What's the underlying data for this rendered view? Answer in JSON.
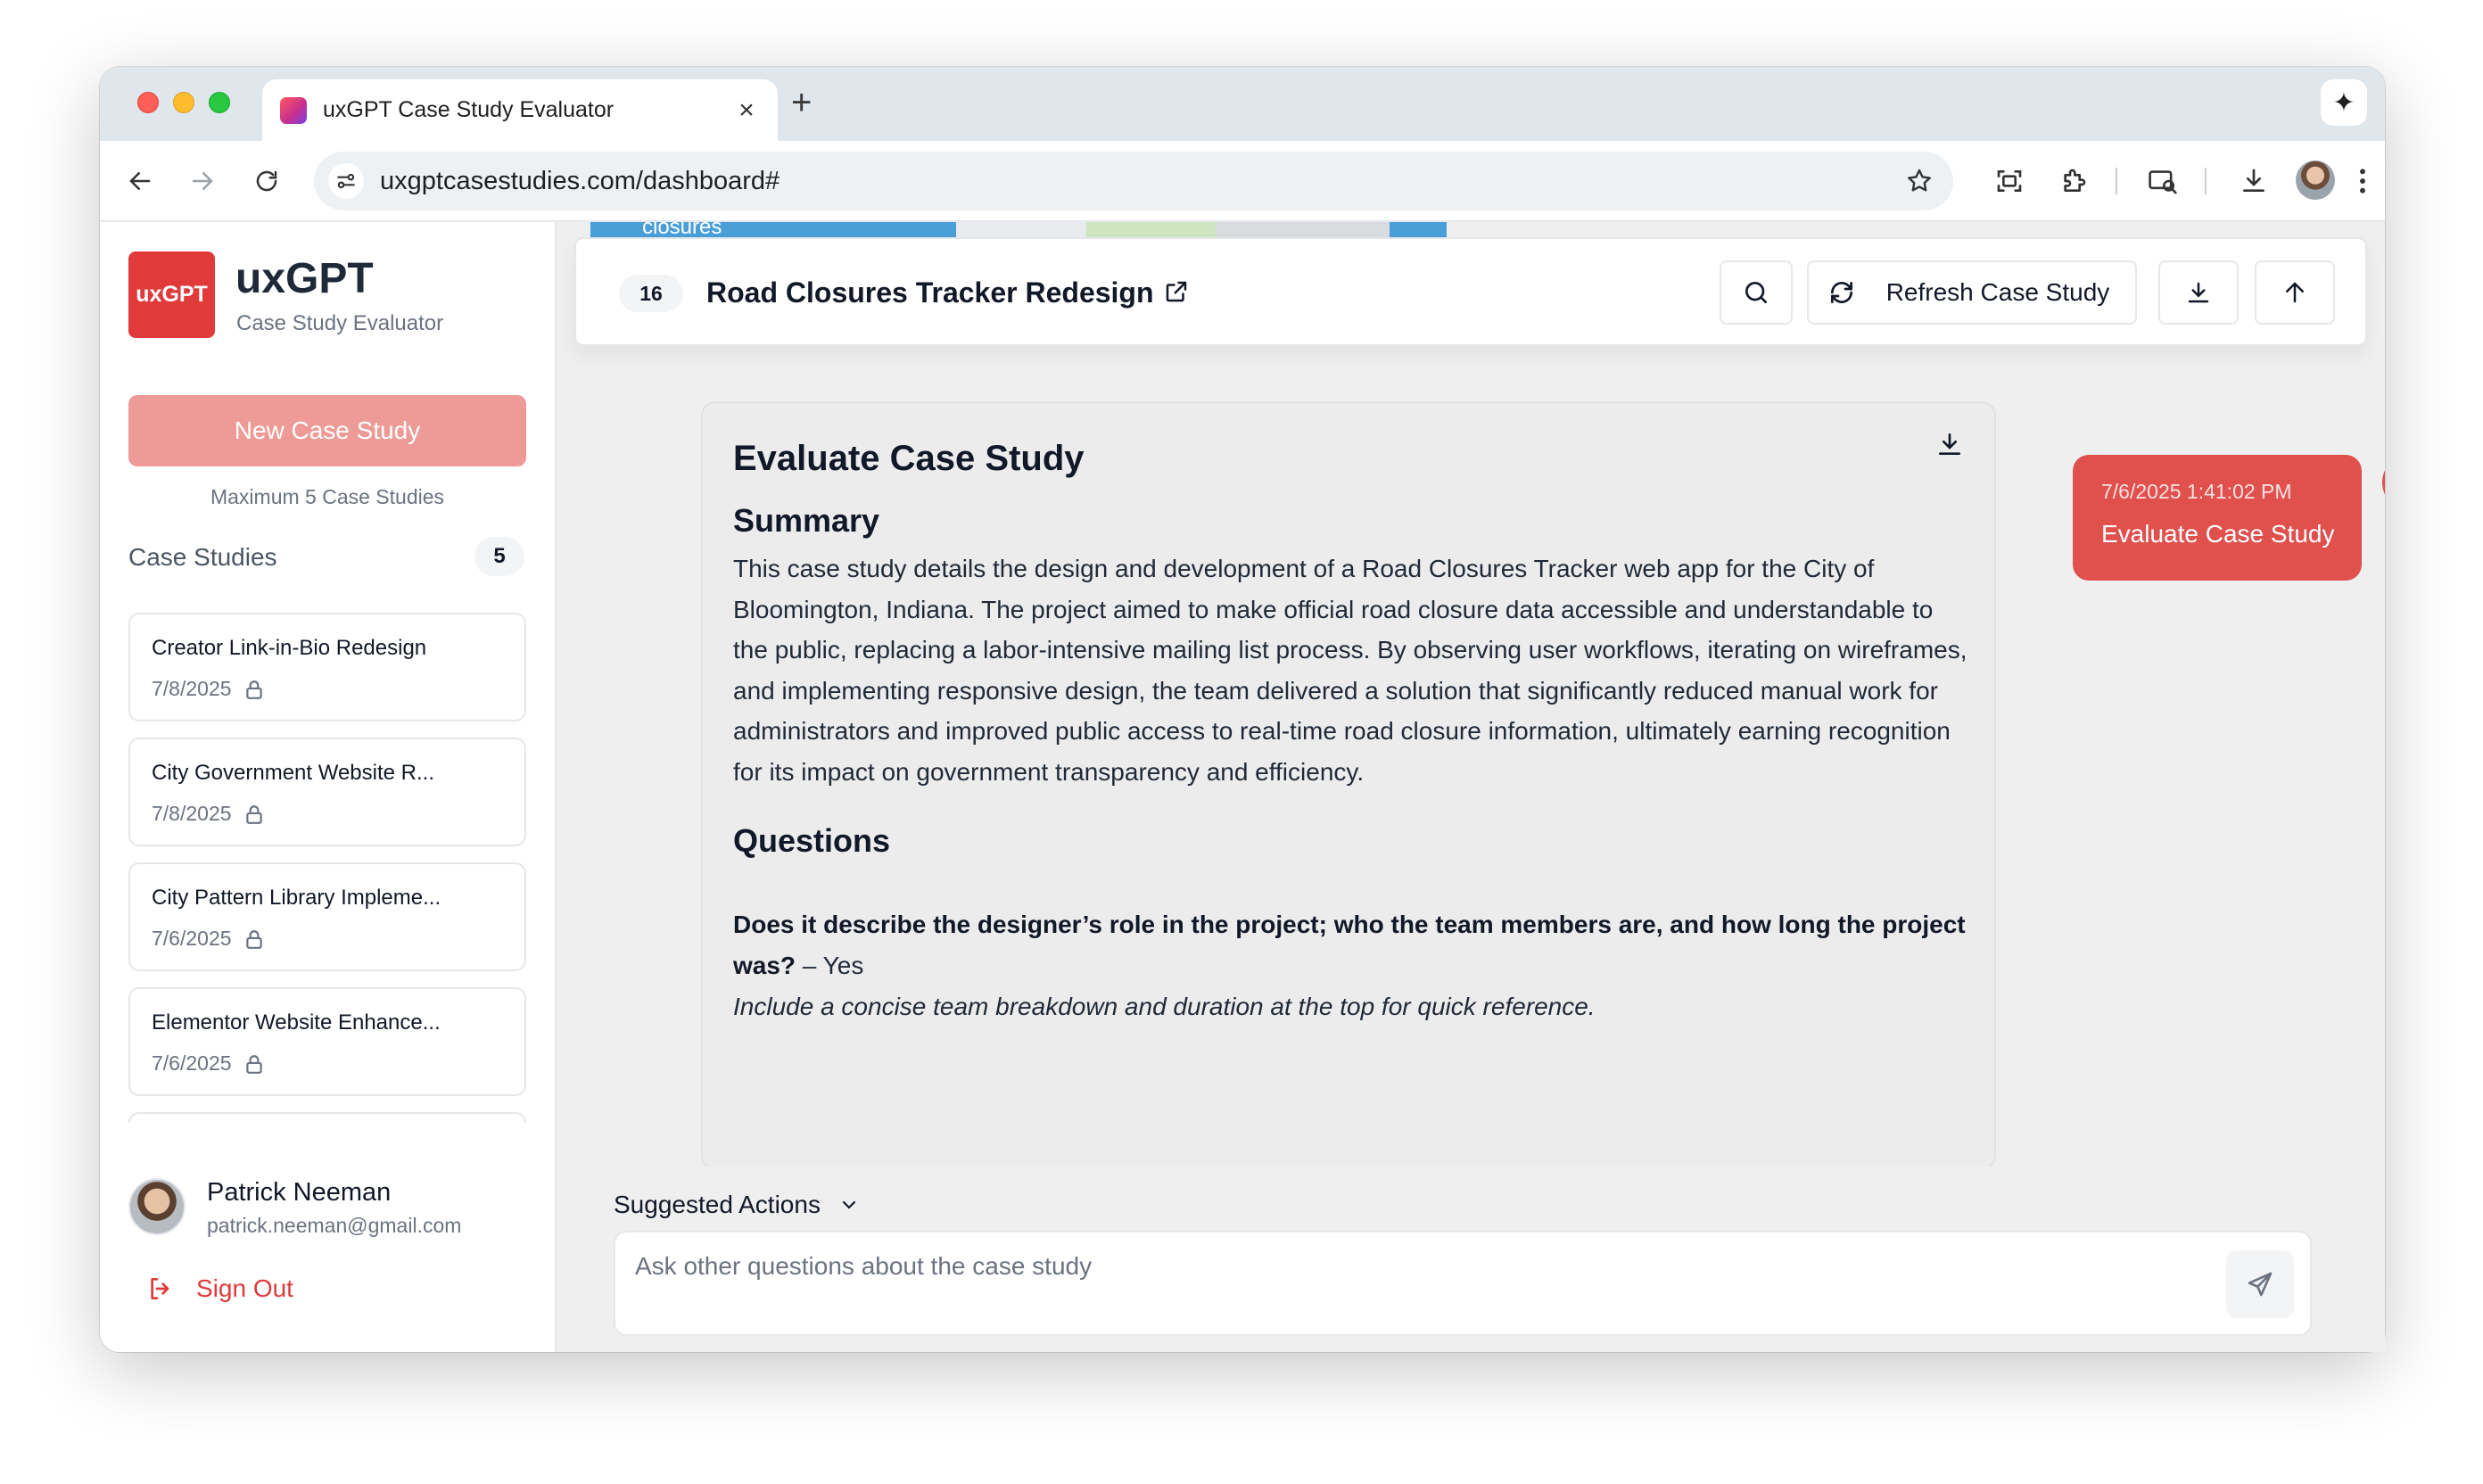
{
  "browser": {
    "tab_title": "uxGPT Case Study Evaluator",
    "tab_close": "×",
    "new_tab": "+",
    "url": "uxgptcasestudies.com/dashboard#",
    "gemini_icon": "✦"
  },
  "sidebar": {
    "logo_text": "uxGPT",
    "app_name": "uxGPT",
    "app_subtitle": "Case Study Evaluator",
    "new_button": "New Case Study",
    "max_note": "Maximum 5 Case Studies",
    "list_heading": "Case Studies",
    "list_count": "5",
    "items": [
      {
        "title": "Creator Link-in-Bio Redesign",
        "date": "7/8/2025"
      },
      {
        "title": "City Government Website R...",
        "date": "7/8/2025"
      },
      {
        "title": "City Pattern Library Impleme...",
        "date": "7/6/2025"
      },
      {
        "title": "Elementor Website Enhance...",
        "date": "7/6/2025"
      }
    ],
    "user": {
      "name": "Patrick Neeman",
      "email": "patrick.neeman@gmail.com"
    },
    "sign_out": "Sign Out"
  },
  "main": {
    "peek_text": "closures",
    "header": {
      "count": "16",
      "title": "Road Closures Tracker Redesign",
      "refresh_label": "Refresh Case Study"
    },
    "user_message": {
      "timestamp": "7/6/2025 1:41:02 PM",
      "text": "Evaluate Case Study"
    },
    "ai_message": {
      "heading": "Evaluate Case Study",
      "summary_heading": "Summary",
      "summary": "This case study details the design and development of a Road Closures Tracker web app for the City of Bloomington, Indiana. The project aimed to make official road closure data accessible and understandable to the public, replacing a labor-intensive mailing list process. By observing user workflows, iterating on wireframes, and implementing responsive design, the team delivered a solution that significantly reduced manual work for administrators and improved public access to real-time road closure information, ultimately earning recognition for its impact on government transparency and efficiency.",
      "questions_heading": "Questions",
      "question_1": "Does it describe the designer’s role in the project; who the team members are, and how long the project was?",
      "answer_1": " – Yes",
      "hint_1": "Include a concise team breakdown and duration at the top for quick reference."
    },
    "suggested_actions": "Suggested Actions",
    "input_placeholder": "Ask other questions about the case study",
    "input_value": ""
  },
  "colors": {
    "brand_red": "#e03a3a",
    "bubble_red": "#e0504d",
    "button_disabled": "#ee9a97"
  }
}
